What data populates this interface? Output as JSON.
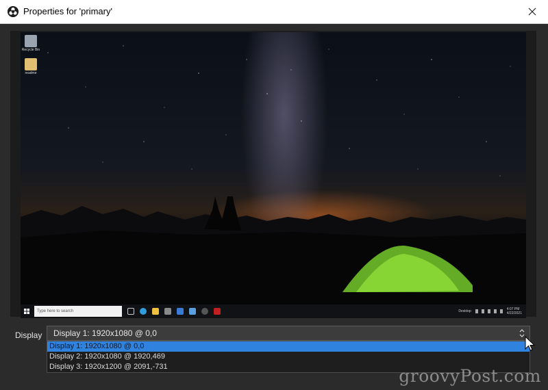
{
  "window": {
    "title": "Properties for 'primary'",
    "close_icon": "close-icon",
    "app_icon": "obs-logo-icon"
  },
  "preview": {
    "desktop_icons": [
      {
        "label": "Recycle Bin",
        "icon": "recycle-bin-icon"
      },
      {
        "label": "readme",
        "icon": "file-icon"
      }
    ],
    "taskbar": {
      "search_placeholder": "Type here to search",
      "tray_text": "Desktop",
      "clock_time": "4:07 PM",
      "clock_date": "4/22/2021"
    }
  },
  "display": {
    "label": "Display",
    "selected": "Display 1: 1920x1080 @ 0,0",
    "options": [
      "Display 1: 1920x1080 @ 0,0",
      "Display 2: 1920x1080 @ 1920,469",
      "Display 3: 1920x1200 @ 2091,-731"
    ],
    "selected_index": 0
  },
  "watermark": "groovyPost.com",
  "colors": {
    "selection": "#2f82de",
    "background": "#2b2b2b"
  }
}
